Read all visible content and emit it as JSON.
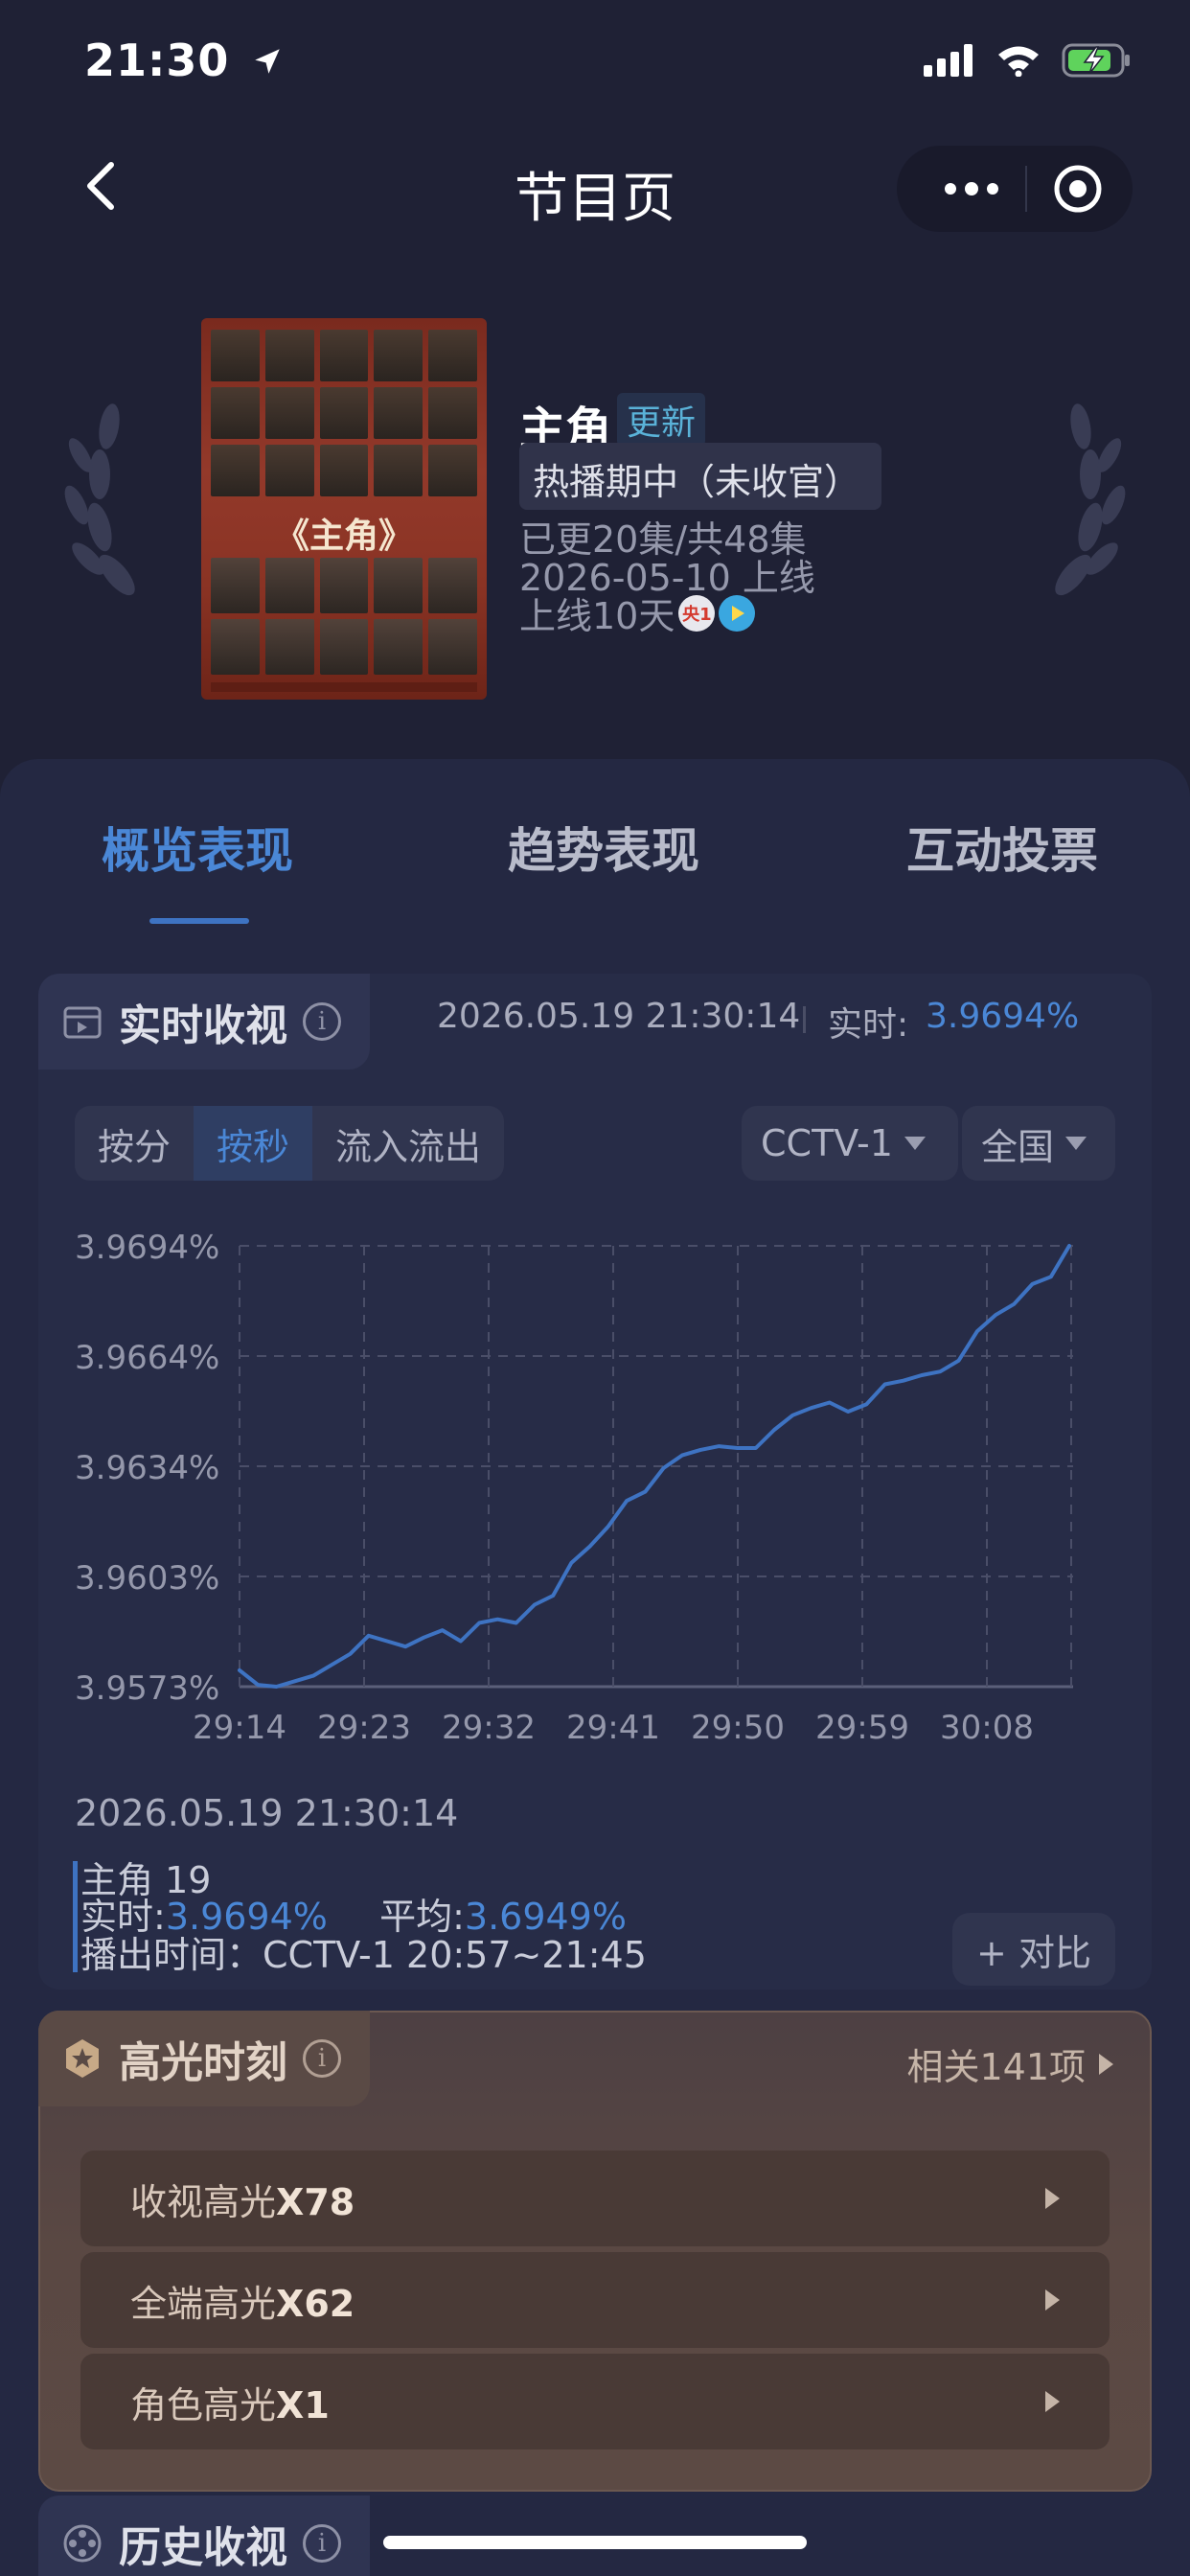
{
  "status_bar": {
    "time": "21:30"
  },
  "nav": {
    "title": "节目页"
  },
  "program": {
    "poster_title": "《主角》",
    "name": "主角",
    "badge": "更新",
    "status": "热播期中（未收官）",
    "episodes": "已更20集/共48集",
    "premiere": "2026-05-10 上线",
    "days_online": "上线10天",
    "channel_badge": "央1"
  },
  "tabs": [
    {
      "label": "概览表现",
      "active": true
    },
    {
      "label": "趋势表现",
      "active": false
    },
    {
      "label": "互动投票",
      "active": false
    }
  ],
  "realtime": {
    "title": "实时收视",
    "timestamp": "2026.05.19 21:30:14",
    "label": "实时:",
    "value": "3.9694%",
    "segments": [
      {
        "label": "按分",
        "active": false
      },
      {
        "label": "按秒",
        "active": true
      },
      {
        "label": "流入流出",
        "active": false
      }
    ],
    "channel_select": "CCTV-1",
    "region_select": "全国"
  },
  "chart_data": {
    "type": "line",
    "ylim": [
      3.9573,
      3.9694
    ],
    "y_ticks": [
      "3.9694%",
      "3.9664%",
      "3.9634%",
      "3.9603%",
      "3.9573%"
    ],
    "x_ticks": [
      "29:14",
      "29:23",
      "29:32",
      "29:41",
      "29:50",
      "29:59",
      "30:08"
    ],
    "grid": true,
    "series": [
      {
        "color": "#3e73c2",
        "points": [
          [
            0,
            3.95775
          ],
          [
            1,
            3.95735
          ],
          [
            2,
            3.9573
          ],
          [
            3,
            3.95745
          ],
          [
            4,
            3.9576
          ],
          [
            5,
            3.9579
          ],
          [
            6,
            3.9582
          ],
          [
            7,
            3.9587
          ],
          [
            8,
            3.95855
          ],
          [
            9,
            3.9584
          ],
          [
            10,
            3.95865
          ],
          [
            11,
            3.95885
          ],
          [
            12,
            3.95855
          ],
          [
            13,
            3.95905
          ],
          [
            14,
            3.95915
          ],
          [
            15,
            3.95905
          ],
          [
            16,
            3.95955
          ],
          [
            17,
            3.9598
          ],
          [
            18,
            3.9607
          ],
          [
            19,
            3.96115
          ],
          [
            20,
            3.9617
          ],
          [
            21,
            3.9624
          ],
          [
            22,
            3.96265
          ],
          [
            23,
            3.9633
          ],
          [
            24,
            3.96365
          ],
          [
            25,
            3.9638
          ],
          [
            26,
            3.9639
          ],
          [
            27,
            3.96385
          ],
          [
            28,
            3.96385
          ],
          [
            29,
            3.96435
          ],
          [
            30,
            3.96475
          ],
          [
            31,
            3.96495
          ],
          [
            32,
            3.9651
          ],
          [
            33,
            3.96485
          ],
          [
            34,
            3.96505
          ],
          [
            35,
            3.9656
          ],
          [
            36,
            3.9657
          ],
          [
            37,
            3.96585
          ],
          [
            38,
            3.96595
          ],
          [
            39,
            3.96625
          ],
          [
            40,
            3.96705
          ],
          [
            41,
            3.9675
          ],
          [
            42,
            3.9678
          ],
          [
            43,
            3.96835
          ],
          [
            44,
            3.96855
          ],
          [
            45,
            3.9694
          ]
        ]
      }
    ]
  },
  "selection": {
    "timestamp": "2026.05.19 21:30:14",
    "program_line": "主角 19",
    "realtime_label": "实时:",
    "realtime_value": "3.9694%",
    "avg_label": "平均:",
    "avg_value": "3.6949%",
    "air_time": "播出时间：CCTV-1 20:57~21:45",
    "compare_label": "+ 对比"
  },
  "highlights": {
    "title": "高光时刻",
    "related": "相关141项",
    "rows": [
      {
        "label": "收视高光",
        "count": "X78"
      },
      {
        "label": "全端高光",
        "count": "X62"
      },
      {
        "label": "角色高光",
        "count": "X1"
      }
    ]
  },
  "history": {
    "title": "历史收视"
  },
  "colors": {
    "accent": "#4a87d6",
    "background": "#1f2135",
    "panel": "#242842"
  }
}
